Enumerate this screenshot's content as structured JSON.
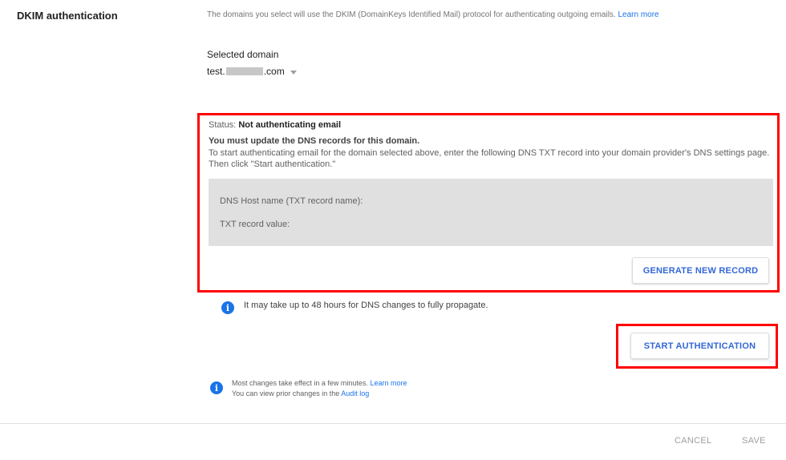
{
  "section": {
    "title": "DKIM authentication",
    "description": "The domains you select will use the DKIM (DomainKeys Identified Mail) protocol for authenticating outgoing emails.",
    "learn_more": "Learn more"
  },
  "domain_select": {
    "label": "Selected domain",
    "value_prefix": "test.",
    "value_suffix": ".com",
    "icon": "dropdown-caret-icon"
  },
  "status_panel": {
    "status_label": "Status:",
    "status_value": "Not authenticating email",
    "heading": "You must update the DNS records for this domain.",
    "instructions": "To start authenticating email for the domain selected above, enter the following DNS TXT record into your domain provider's DNS settings page. Then click \"Start authentication.\"",
    "dns_host_label": "DNS Host name (TXT record name):",
    "txt_value_label": "TXT record value:",
    "generate_button": "GENERATE NEW RECORD"
  },
  "propagation_note": "It may take up to 48 hours for DNS changes to fully propagate.",
  "start_button": "START AUTHENTICATION",
  "footer_note": {
    "line1": "Most changes take effect in a few minutes.",
    "line1_link": "Learn more",
    "line2": "You can view prior changes in the",
    "line2_link": "Audit log"
  },
  "footer": {
    "cancel": "CANCEL",
    "save": "SAVE"
  },
  "colors": {
    "accent": "#1a73e8",
    "highlight": "#ff0000",
    "panel_gray": "#e0e0e0"
  }
}
